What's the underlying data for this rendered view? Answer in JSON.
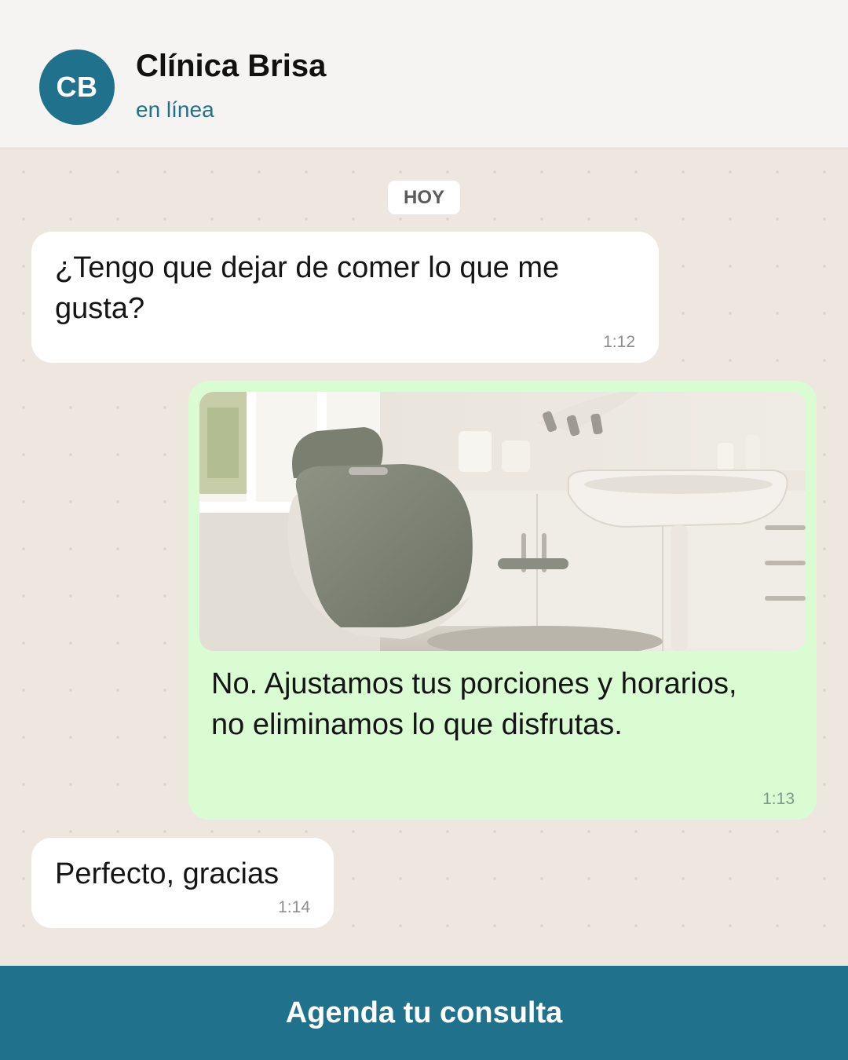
{
  "header": {
    "avatar_initials": "CB",
    "title": "Clínica Brisa",
    "status": "en línea"
  },
  "chat": {
    "day_label": "HOY",
    "messages": [
      {
        "direction": "incoming",
        "text": "¿Tengo que dejar de comer lo que me gusta?",
        "time": "1:12"
      },
      {
        "direction": "outgoing",
        "image": "dental-chair-photo",
        "text": "No. Ajustamos tus porciones y horarios, no eliminamos lo que disfrutas.",
        "time": "1:13"
      },
      {
        "direction": "incoming",
        "text": "Perfecto, gracias",
        "time": "1:14"
      }
    ]
  },
  "cta": {
    "label": "Agenda tu consulta"
  },
  "colors": {
    "brand": "#20718b",
    "chat_background": "#eee7df",
    "outgoing_bubble": "#d9fcd2",
    "incoming_bubble": "#ffffff"
  }
}
